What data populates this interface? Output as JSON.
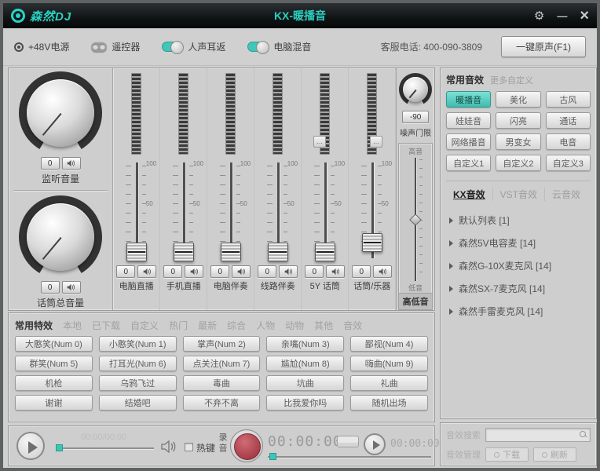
{
  "window": {
    "logo_text": "森然DJ",
    "title": "KX-暖播音",
    "gear": "⚙",
    "minimize": "—",
    "close": "×"
  },
  "toolbar": {
    "phantom_power": "+48V电源",
    "remote": "遥控器",
    "vocal_monitor": "人声耳返",
    "pc_mix": "电脑混音",
    "service_phone": "客服电话: 400-090-3809",
    "one_key_original": "一键原声(F1)"
  },
  "left_panel": {
    "monitor_knob": {
      "value": "0",
      "label": "监听音量"
    },
    "mic_master_knob": {
      "value": "0",
      "label": "话筒总音量"
    }
  },
  "mixer": {
    "scale_top": "100",
    "scale_mid": "50",
    "fx_slot": "…",
    "channels": [
      {
        "label": "电脑直播",
        "value": "0"
      },
      {
        "label": "手机直播",
        "value": "0"
      },
      {
        "label": "电脑伴奏",
        "value": "0"
      },
      {
        "label": "线路伴奏",
        "value": "0"
      },
      {
        "label": "5Y 话筒",
        "value": "0"
      },
      {
        "label": "话筒/乐器",
        "value": "0"
      }
    ]
  },
  "gate": {
    "value": "-90",
    "label": "噪声门限"
  },
  "tone": {
    "top": "高音",
    "bottom": "低音",
    "label": "高低音"
  },
  "effects_panel": {
    "title": "常用音效",
    "more": "更多自定义",
    "buttons": [
      "暖播音",
      "美化",
      "古风",
      "娃娃音",
      "闪亮",
      "通话",
      "网络播音",
      "男变女",
      "电音",
      "自定义1",
      "自定义2",
      "自定义3"
    ]
  },
  "kx_panel": {
    "tabs": [
      "KX音效",
      "VST音效",
      "云音效"
    ],
    "items": [
      "默认列表 [1]",
      "森然5V电容麦 [14]",
      "森然G-10X麦克风 [14]",
      "森然SX-7麦克风 [14]",
      "森然手雷麦克风 [14]"
    ]
  },
  "effects_library": {
    "tabs": [
      "常用特效",
      "本地",
      "已下载",
      "自定义",
      "热门",
      "最新",
      "综合",
      "人物",
      "动物",
      "其他",
      "音效"
    ],
    "buttons": [
      "大憨笑(Num 0)",
      "小憨笑(Num 1)",
      "掌声(Num 2)",
      "亲嘴(Num 3)",
      "鄙视(Num 4)",
      "群笑(Num 5)",
      "打耳光(Num 6)",
      "点关注(Num 7)",
      "尴尬(Num 8)",
      "嗨曲(Num 9)",
      "机枪",
      "乌鸦飞过",
      "毒曲",
      "坑曲",
      "礼曲",
      "谢谢",
      "结婚吧",
      "不弃不离",
      "比我爱你吗",
      "随机出场"
    ]
  },
  "transport": {
    "progress_text": "00:00/00:00",
    "hotkey": "热键",
    "record_label": "录音",
    "record_time": "00:00:00",
    "preview_time": "00:00:00"
  },
  "search_panel": {
    "search_label": "音效搜索",
    "manage_label": "音效管理",
    "download": "下载",
    "refresh": "刷新"
  },
  "colors": {
    "accent": "#3cc6b8",
    "record_red": "#a83f4a",
    "title_teal": "#2bd0c2"
  }
}
